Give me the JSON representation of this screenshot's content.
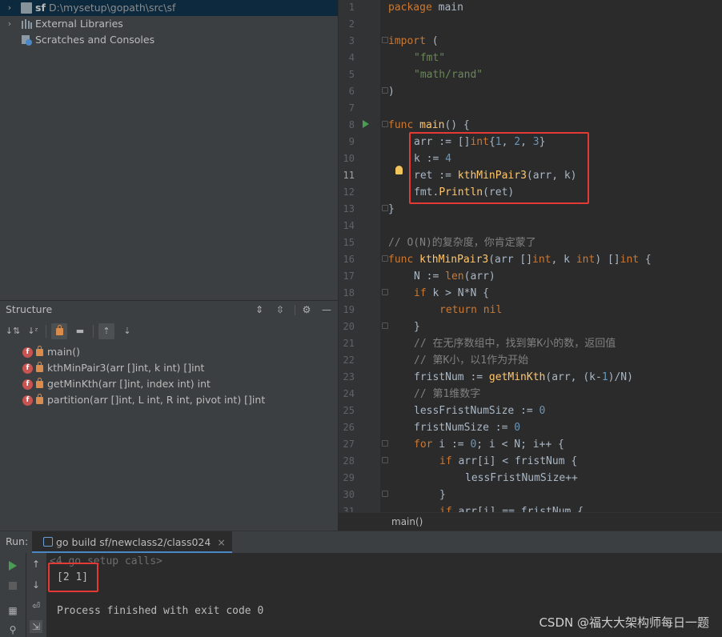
{
  "project": {
    "root_name": "sf",
    "root_path": "D:\\mysetup\\gopath\\src\\sf",
    "external_libraries": "External Libraries",
    "scratches": "Scratches and Consoles"
  },
  "structure": {
    "title": "Structure",
    "items": [
      "main()",
      "kthMinPair3(arr []int, k int) []int",
      "getMinKth(arr []int, index int) int",
      "partition(arr []int, L int, R int, pivot int) []int"
    ]
  },
  "editor": {
    "line_numbers": [
      "1",
      "2",
      "3",
      "4",
      "5",
      "6",
      "7",
      "8",
      "9",
      "10",
      "11",
      "12",
      "13",
      "14",
      "15",
      "16",
      "17",
      "18",
      "19",
      "20",
      "21",
      "22",
      "23",
      "24",
      "25",
      "26",
      "27",
      "28",
      "29",
      "30",
      "31"
    ],
    "current_line": "11",
    "breadcrumb": "main()",
    "lines": {
      "l1_kw": "package",
      "l1_name": " main",
      "l3_kw": "import",
      "l3_paren": " (",
      "l4": "\"fmt\"",
      "l5": "\"math/rand\"",
      "l6": ")",
      "l8_kw": "func",
      "l8_fn": " main",
      "l8_rest": "() {",
      "l9_a": "arr := []",
      "l9_kw": "int",
      "l9_b": "{",
      "l9_n1": "1",
      "l9_c1": ", ",
      "l9_n2": "2",
      "l9_c2": ", ",
      "l9_n3": "3",
      "l9_d": "}",
      "l10_a": "k := ",
      "l10_n": "4",
      "l11_a": "ret := ",
      "l11_fn": "kthMinPair3",
      "l11_b": "(arr, k)",
      "l12_a": "fmt.",
      "l12_fn": "Println",
      "l12_b": "(ret)",
      "l13": "}",
      "l15": "// O(N)的复杂度，你肯定蒙了",
      "l16_kw": "func",
      "l16_fn": " kthMinPair3",
      "l16_a": "(arr []",
      "l16_kw2": "int",
      "l16_b": ", k ",
      "l16_kw3": "int",
      "l16_c": ") []",
      "l16_kw4": "int",
      "l16_d": " {",
      "l17_a": "N := ",
      "l17_fn": "len",
      "l17_b": "(arr)",
      "l18_kw": "if",
      "l18_a": " k > N*N {",
      "l19_kw": "return",
      "l19_a": " nil",
      "l20": "}",
      "l21": "// 在无序数组中，找到第K小的数，返回值",
      "l22": "// 第K小，以1作为开始",
      "l23_a": "fristNum := ",
      "l23_fn": "getMinKth",
      "l23_b": "(arr, (k-",
      "l23_n": "1",
      "l23_c": ")/N)",
      "l24": "// 第1维数字",
      "l25_a": "lessFristNumSize := ",
      "l25_n": "0",
      "l26_a": "fristNumSize := ",
      "l26_n": "0",
      "l27_kw": "for",
      "l27_a": " i := ",
      "l27_n": "0",
      "l27_b": "; i < N; i++ {",
      "l28_kw": "if",
      "l28_a": " arr[i] < fristNum {",
      "l29": "lessFristNumSize++",
      "l30": "}",
      "l31_kw": "if",
      "l31_a": " arr[i] == fristNum {"
    }
  },
  "run": {
    "label": "Run:",
    "tab": "go build sf/newclass2/class024",
    "setup_calls": "<4 go setup calls>",
    "output": "[2 1]",
    "finished": "Process finished with exit code 0"
  },
  "watermark": "CSDN @福大大架构师每日一题",
  "colors": {
    "keyword": "#cc7832",
    "string": "#6a8759",
    "number": "#6897bb",
    "function": "#ffc66d",
    "comment": "#808080",
    "highlight_box": "#e53935"
  }
}
